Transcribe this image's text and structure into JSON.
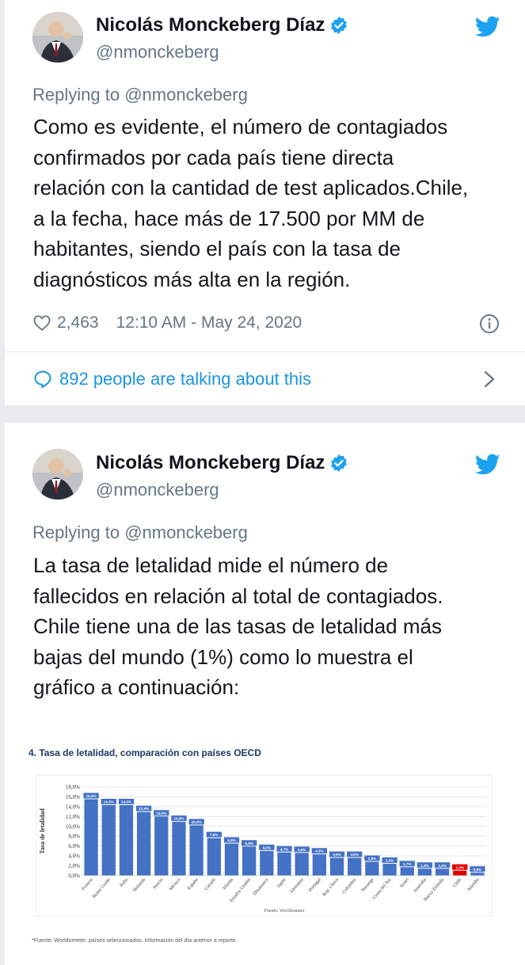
{
  "colors": {
    "accent": "#1da1f2",
    "link": "#1b95e0",
    "muted": "#657786",
    "bar": "#4472c4",
    "bar_highlight": "#e00000"
  },
  "tweets": [
    {
      "author_name": "Nicolás Monckeberg Díaz",
      "author_handle": "@nmonckeberg",
      "replying_label": "Replying to",
      "replying_handle": "@nmonckeberg",
      "text_lines": [
        "Como es evidente, el número de contagiados",
        "confirmados por cada país tiene directa",
        "relación con la cantidad de test aplicados.Chile,",
        "a la fecha, hace más de 17.500 por MM de",
        "habitantes, siendo el país con la tasa de",
        "diagnósticos más alta en la región."
      ],
      "likes": "2,463",
      "timestamp": "12:10 AM - May 24, 2020",
      "talking": "892 people are talking about this",
      "icons": [
        "verified-badge-icon",
        "twitter-bird-icon",
        "heart-icon",
        "info-icon",
        "speech-bubble-icon",
        "chevron-right-icon"
      ]
    },
    {
      "author_name": "Nicolás Monckeberg Díaz",
      "author_handle": "@nmonckeberg",
      "replying_label": "Replying to",
      "replying_handle": "@nmonckeberg",
      "text_lines": [
        "La tasa de letalidad mide el número de",
        "fallecidos en relación al total de contagiados.",
        "Chile tiene una de las tasas de letalidad más",
        "bajas del mundo (1%) como lo muestra el",
        "gráfico a continuación:"
      ]
    }
  ],
  "chart_data": {
    "type": "bar",
    "title": "4.  Tasa de letalidad, comparación con países OECD",
    "ylabel": "Tasa de letalidad",
    "xlabel": "Fuente: Worldometer",
    "footnote": "*Fuente: Worldometer, países seleccionados. Información del día anterior a reporte.",
    "ylim": [
      0,
      18
    ],
    "yticks": [
      "18,0%",
      "16,0%",
      "14,0%",
      "12,0%",
      "10,0%",
      "8,0%",
      "6,0%",
      "4,0%",
      "2,0%",
      "0,0%"
    ],
    "ytick_values": [
      18,
      16,
      14,
      12,
      10,
      8,
      6,
      4,
      2,
      0
    ],
    "grid": true,
    "highlight_category": "Chile",
    "categories": [
      "Francia",
      "Reino Unido",
      "Italia",
      "Holanda",
      "Suecia",
      "México",
      "España",
      "Canadá",
      "Irlanda",
      "Estados Unidos",
      "Dinamarca",
      "Japón",
      "Alemania",
      "Portugal",
      "Rep. Checa",
      "Colombia",
      "Noruega",
      "Corea del Sur",
      "Israel",
      "Australia",
      "Nueva Zelanda",
      "Chile",
      "Islandia"
    ],
    "values": [
      15.5,
      14.3,
      14.3,
      12.9,
      12.0,
      10.9,
      10.2,
      7.6,
      6.5,
      5.9,
      5.0,
      4.7,
      4.6,
      4.3,
      3.6,
      3.6,
      2.8,
      2.4,
      1.7,
      1.4,
      1.4,
      1.0,
      0.6
    ],
    "value_labels": [
      "15,5%",
      "14,3%",
      "14,3%",
      "12,9%",
      "12,0%",
      "10,9%",
      "10,2%",
      "7,6%",
      "6,5%",
      "5,9%",
      "5,0%",
      "4,7%",
      "4,6%",
      "4,3%",
      "3,6%",
      "3,6%",
      "2,8%",
      "2,4%",
      "1,7%",
      "1,4%",
      "1,4%",
      "1,0%",
      "0,6%"
    ]
  }
}
